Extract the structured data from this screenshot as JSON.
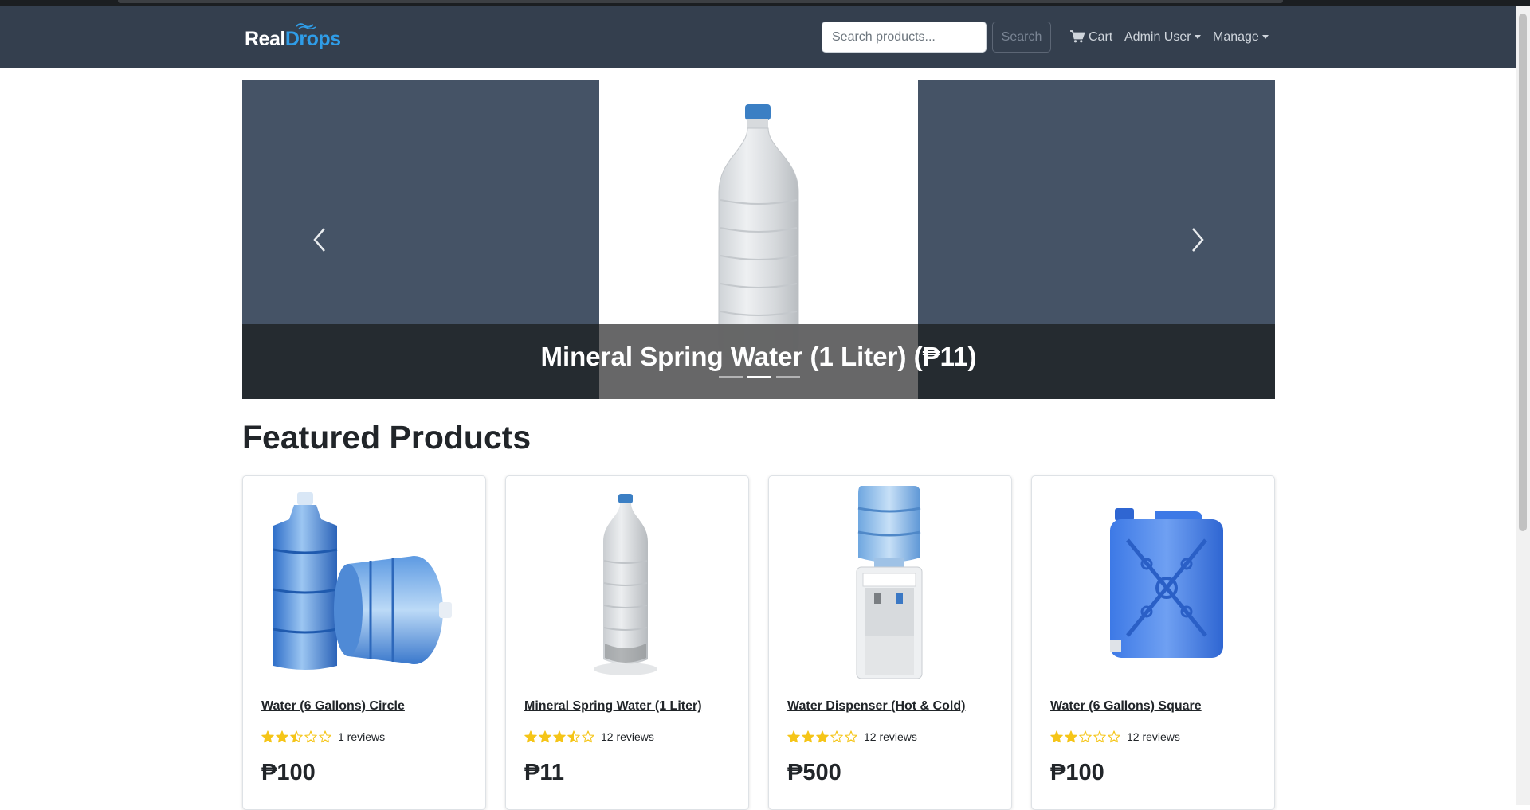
{
  "brand": {
    "name_part1": "Real",
    "name_part2": "Drops"
  },
  "search": {
    "placeholder": "Search products...",
    "button_label": "Search"
  },
  "nav": {
    "cart_label": "Cart",
    "user_label": "Admin User",
    "manage_label": "Manage"
  },
  "carousel": {
    "caption": "Mineral Spring Water (1 Liter) (₱11)",
    "slide_count": 3,
    "active_index": 1
  },
  "featured": {
    "title": "Featured Products",
    "products": [
      {
        "name": "Water (6 Gallons) Circle",
        "rating": 2.5,
        "reviews": "1 reviews",
        "price": "₱100",
        "image": "gallon-jugs"
      },
      {
        "name": "Mineral Spring Water (1 Liter)",
        "rating": 3.5,
        "reviews": "12 reviews",
        "price": "₱11",
        "image": "water-bottle"
      },
      {
        "name": "Water Dispenser (Hot & Cold)",
        "rating": 3,
        "reviews": "12 reviews",
        "price": "₱500",
        "image": "water-dispenser"
      },
      {
        "name": "Water (6 Gallons) Square",
        "rating": 2,
        "reviews": "12 reviews",
        "price": "₱100",
        "image": "square-jug"
      }
    ]
  },
  "colors": {
    "navbar": "#343f4e",
    "brand_accent": "#2f9de8",
    "star": "#f5c518",
    "carousel_bg": "#455366"
  }
}
